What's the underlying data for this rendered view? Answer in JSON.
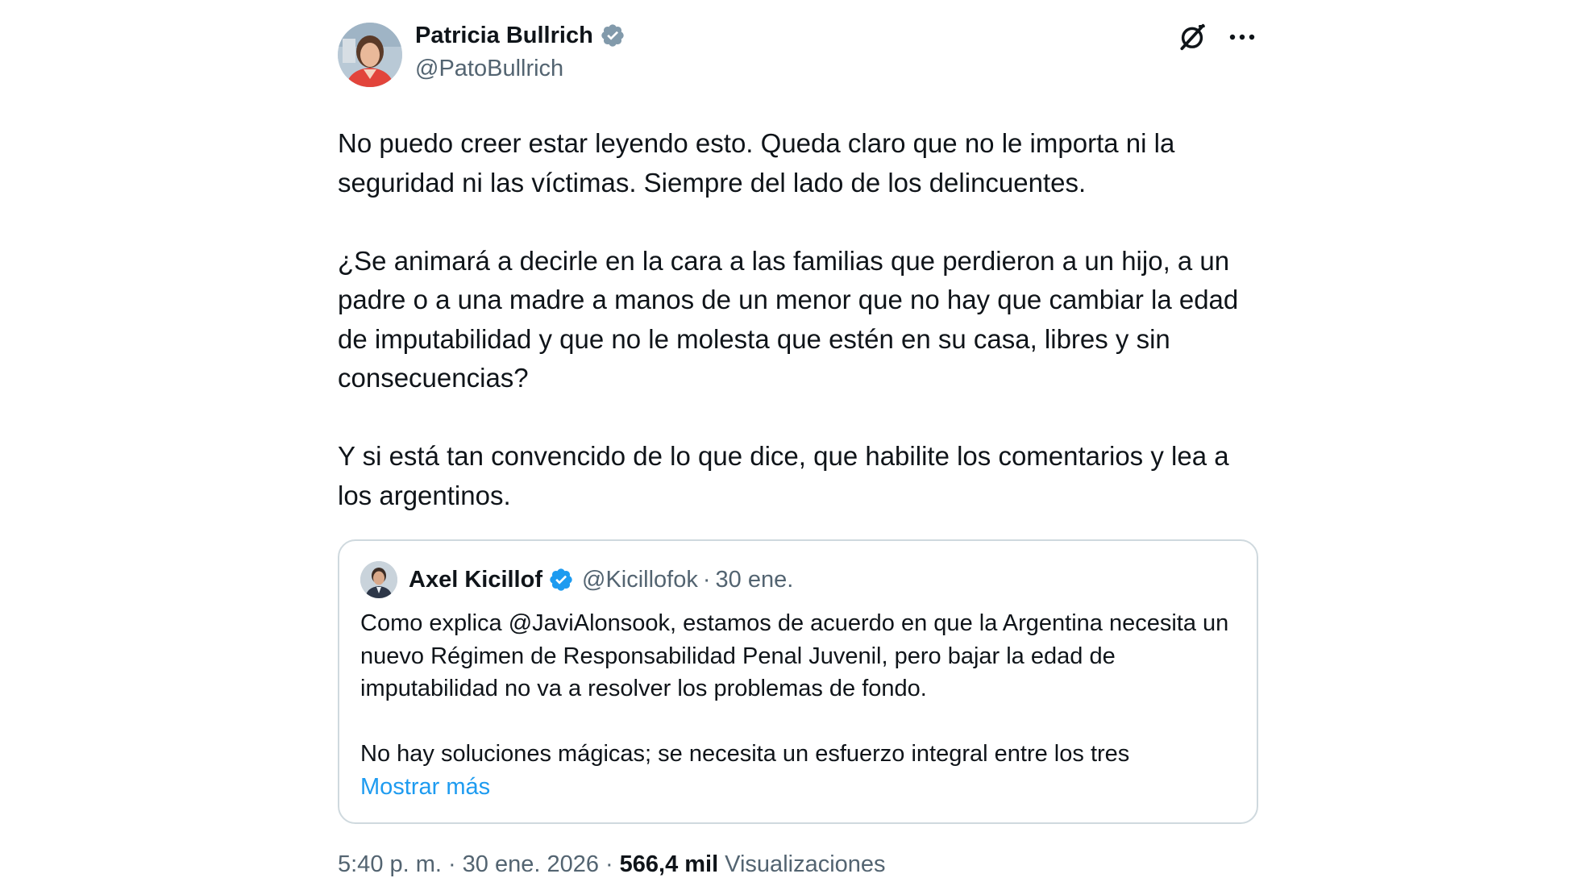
{
  "author": {
    "name": "Patricia Bullrich",
    "handle": "@PatoBullrich",
    "verified_color": "#829aab"
  },
  "tweet": {
    "paragraphs": [
      "No puedo creer estar leyendo esto. Queda claro que no le importa ni la seguridad ni las víctimas. Siempre del lado de los delincuentes.",
      "¿Se animará a decirle en la cara a las familias que perdieron a un hijo, a un padre o a una madre a manos de un menor que no hay que cambiar la edad de imputabilidad y que no le molesta que estén en su casa, libres y sin consecuencias?",
      "Y si está tan convencido de lo que dice, que habilite los comentarios y lea a los argentinos."
    ]
  },
  "header_icons": [
    "grok-icon",
    "more-options-icon"
  ],
  "quote": {
    "name": "Axel Kicillof",
    "handle": "@Kicillofok",
    "separator": "·",
    "date": "30 ene.",
    "verified_color": "#1d9bf0",
    "paragraphs": [
      "Como explica @JaviAlonsook, estamos de acuerdo en que la Argentina necesita un nuevo Régimen de Responsabilidad Penal Juvenil, pero bajar la edad de imputabilidad no va a resolver los problemas de fondo.",
      "No hay soluciones mágicas; se necesita un esfuerzo integral entre los tres"
    ],
    "show_more": "Mostrar más"
  },
  "meta": {
    "time": "5:40 p. m.",
    "date": "30 ene. 2026",
    "separator": "·",
    "views_count": "566,4 mil",
    "views_label": "Visualizaciones"
  },
  "colors": {
    "text": "#0f1419",
    "secondary": "#536471",
    "link": "#1d9bf0",
    "border": "#cfd9de"
  }
}
